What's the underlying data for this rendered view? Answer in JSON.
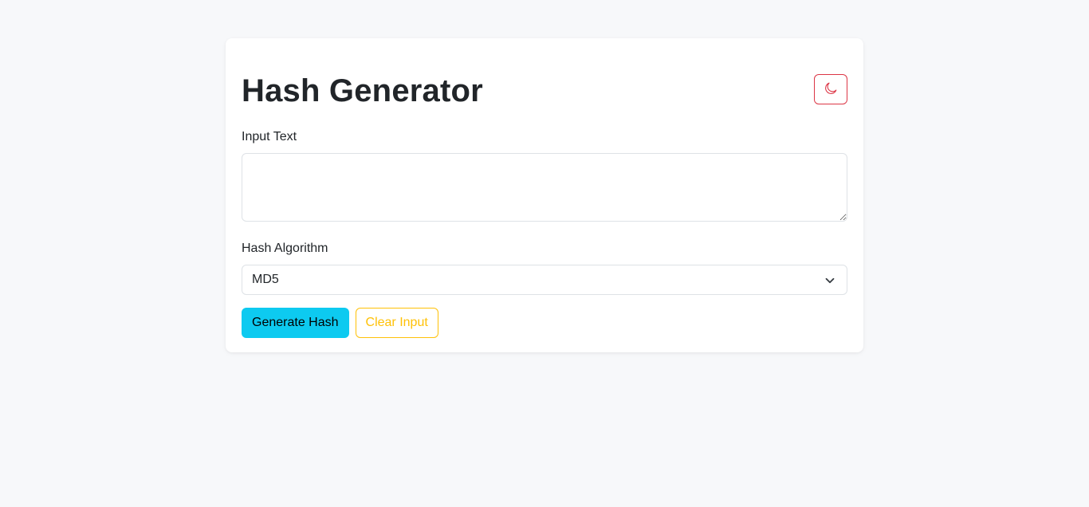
{
  "app": {
    "title": "Hash Generator"
  },
  "theme_toggle": {
    "icon": "moon-icon",
    "color": "#dc3545"
  },
  "input_section": {
    "label": "Input Text",
    "value": "",
    "placeholder": ""
  },
  "algorithm_section": {
    "label": "Hash Algorithm",
    "selected": "MD5"
  },
  "actions": {
    "generate_label": "Generate Hash",
    "generate_color": "#0dcaf0",
    "clear_label": "Clear Input",
    "clear_color": "#ffc107"
  }
}
